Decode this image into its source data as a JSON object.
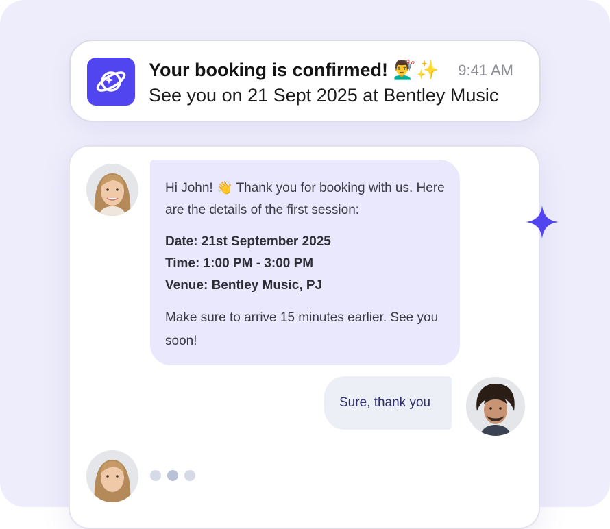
{
  "notification": {
    "title": "Your booking is confirmed! 💇‍♂️✨",
    "time": "9:41 AM",
    "body": "See you on 21 Sept 2025 at Bentley Music",
    "app_icon": "planet-sparkle-icon"
  },
  "chat": {
    "incoming": {
      "greeting": "Hi John! 👋 Thank you for booking with us. Here are the details of the first session:",
      "date": "Date: 21st September 2025",
      "time": "Time: 1:00 PM - 3:00 PM",
      "venue": "Venue: Bentley Music, PJ",
      "closing": "Make sure to arrive 15 minutes earlier. See you soon!"
    },
    "outgoing": {
      "text": "Sure, thank you"
    },
    "typing_indicator_dots": 3
  },
  "colors": {
    "accent": "#5145f0",
    "background": "#eeedfb",
    "incoming_bubble": "#eae8fd",
    "outgoing_bubble": "#eceff5"
  }
}
